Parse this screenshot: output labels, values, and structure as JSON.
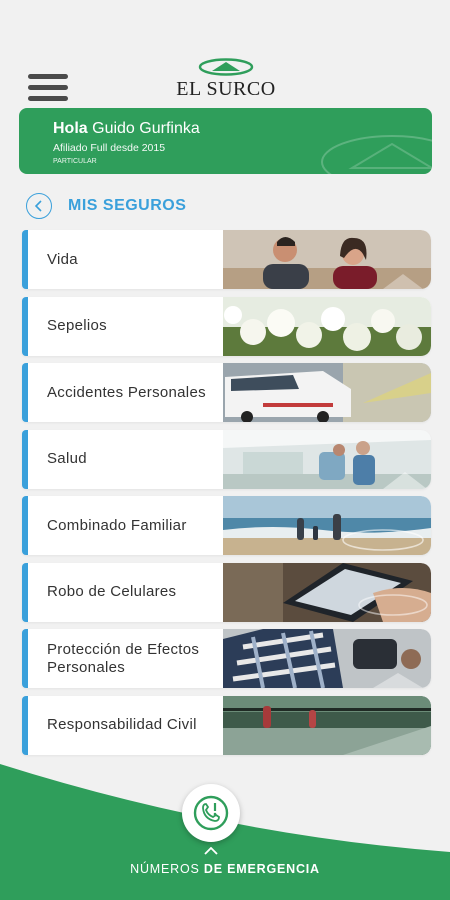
{
  "header": {
    "brand": "EL SURCO"
  },
  "user": {
    "hello": "Hola",
    "name": "Guido Gurfinka",
    "since": "Afiliado Full desde 2015",
    "plan": "PARTICULAR"
  },
  "section": {
    "title": "MIS SEGUROS"
  },
  "insurance_items": [
    {
      "label": "Vida",
      "image": "couple-photo"
    },
    {
      "label": "Sepelios",
      "image": "white-flowers-photo"
    },
    {
      "label": "Accidentes Personales",
      "image": "ambulance-photo"
    },
    {
      "label": "Salud",
      "image": "hospital-hallway-photo"
    },
    {
      "label": "Combinado Familiar",
      "image": "family-beach-photo"
    },
    {
      "label": "Robo de Celulares",
      "image": "smartphone-hand-photo"
    },
    {
      "label": "Protección de Efectos Personales",
      "image": "bag-and-accessories-photo"
    },
    {
      "label": "Responsabilidad Civil",
      "image": "skatepark-photo"
    }
  ],
  "footer": {
    "emergency_prefix": "NÚMEROS",
    "emergency_bold": "DE EMERGENCIA",
    "icon": "emergency-phone-icon"
  },
  "colors": {
    "brand_green": "#2f9e5b",
    "accent_blue": "#3aa0db",
    "background": "#f1f1f1"
  }
}
